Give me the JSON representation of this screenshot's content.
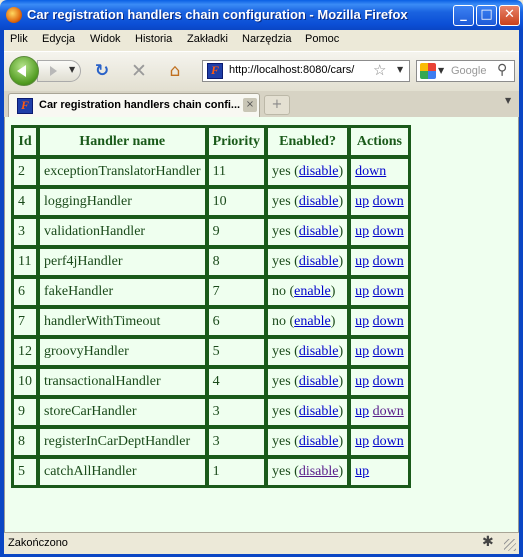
{
  "window": {
    "title": "Car registration handlers chain configuration - Mozilla Firefox",
    "minimize": "_",
    "maximize": "□",
    "close": "✕"
  },
  "menu": [
    "Plik",
    "Edycja",
    "Widok",
    "Historia",
    "Zakładki",
    "Narzędzia",
    "Pomoc"
  ],
  "toolbar": {
    "url": "http://localhost:8080/cars/",
    "search_placeholder": "Google",
    "icons": [
      "back-icon",
      "forward-icon",
      "reload-icon",
      "stop-icon",
      "home-icon",
      "bookmark-star-icon",
      "search-engine-icon",
      "magnifier-icon"
    ]
  },
  "tab": {
    "label": "Car registration handlers chain confi...",
    "close": "×",
    "new_tab": "+",
    "list_all": "▼"
  },
  "table": {
    "headers": [
      "Id",
      "Handler name",
      "Priority",
      "Enabled?",
      "Actions"
    ],
    "rows": [
      {
        "id": "2",
        "name": "exceptionTranslatorHandler",
        "priority": "11",
        "enabled_prefix": "yes (",
        "toggle": "disable",
        "enabled_suffix": ")",
        "up": "",
        "down": "down"
      },
      {
        "id": "4",
        "name": "loggingHandler",
        "priority": "10",
        "enabled_prefix": "yes (",
        "toggle": "disable",
        "enabled_suffix": ")",
        "up": "up",
        "down": "down"
      },
      {
        "id": "3",
        "name": "validationHandler",
        "priority": "9",
        "enabled_prefix": "yes (",
        "toggle": "disable",
        "enabled_suffix": ")",
        "up": "up",
        "down": "down"
      },
      {
        "id": "11",
        "name": "perf4jHandler",
        "priority": "8",
        "enabled_prefix": "yes (",
        "toggle": "disable",
        "enabled_suffix": ")",
        "up": "up",
        "down": "down"
      },
      {
        "id": "6",
        "name": "fakeHandler",
        "priority": "7",
        "enabled_prefix": "no (",
        "toggle": "enable",
        "enabled_suffix": ")",
        "up": "up",
        "down": "down"
      },
      {
        "id": "7",
        "name": "handlerWithTimeout",
        "priority": "6",
        "enabled_prefix": "no (",
        "toggle": "enable",
        "enabled_suffix": ")",
        "up": "up",
        "down": "down"
      },
      {
        "id": "12",
        "name": "groovyHandler",
        "priority": "5",
        "enabled_prefix": "yes (",
        "toggle": "disable",
        "enabled_suffix": ")",
        "up": "up",
        "down": "down"
      },
      {
        "id": "10",
        "name": "transactionalHandler",
        "priority": "4",
        "enabled_prefix": "yes (",
        "toggle": "disable",
        "enabled_suffix": ")",
        "up": "up",
        "down": "down"
      },
      {
        "id": "9",
        "name": "storeCarHandler",
        "priority": "3",
        "enabled_prefix": "yes (",
        "toggle": "disable",
        "enabled_suffix": ")",
        "up": "up",
        "down": "down"
      },
      {
        "id": "8",
        "name": "registerInCarDeptHandler",
        "priority": "3",
        "enabled_prefix": "yes (",
        "toggle": "disable",
        "enabled_suffix": ")",
        "up": "up",
        "down": "down"
      },
      {
        "id": "5",
        "name": "catchAllHandler",
        "priority": "1",
        "enabled_prefix": "yes (",
        "toggle": "disable",
        "enabled_suffix": ")",
        "up": "up",
        "down": ""
      }
    ]
  },
  "status": {
    "text": "Zakończono"
  },
  "colors": {
    "page_background": "#efffef",
    "table_border": "#1a5a1a",
    "link": "#0000cc",
    "visited_link": "#551a8b"
  }
}
